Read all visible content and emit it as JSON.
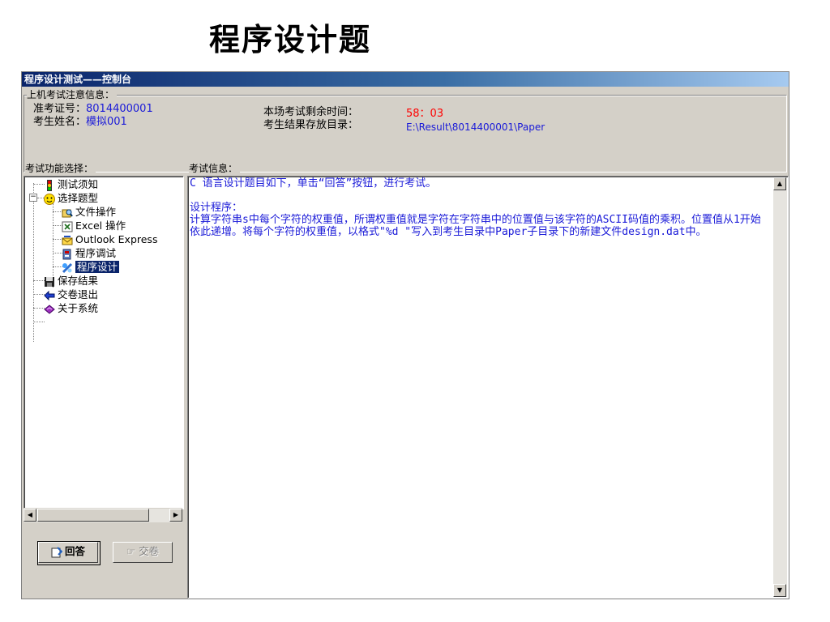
{
  "page": {
    "heading": "程序设计题"
  },
  "window": {
    "title": "程序设计测试——控制台"
  },
  "info": {
    "group_label": "上机考试注意信息：",
    "exam_id_label": "准考证号：",
    "exam_id_value": "8014400001",
    "name_label": "考生姓名：",
    "name_value": "模拟001",
    "time_label": "本场考试剩余时间：",
    "time_value": "58：03",
    "dir_label": "考生结果存放目录：",
    "dir_value": "E:\\Result\\8014400001\\Paper"
  },
  "left": {
    "group_label": "考试功能选择：",
    "tree": [
      {
        "label": "测试须知",
        "icon": "traffic-light-icon"
      },
      {
        "label": "选择题型",
        "icon": "smiley-icon"
      },
      {
        "label": "文件操作",
        "icon": "file-search-icon"
      },
      {
        "label": "Excel 操作",
        "icon": "excel-icon"
      },
      {
        "label": "Outlook Express",
        "icon": "outlook-icon"
      },
      {
        "label": "程序调试",
        "icon": "debug-icon"
      },
      {
        "label": "程序设计",
        "icon": "program-design-icon"
      },
      {
        "label": "保存结果",
        "icon": "floppy-disk-icon"
      },
      {
        "label": "交卷退出",
        "icon": "exit-arrow-icon"
      },
      {
        "label": "关于系统",
        "icon": "about-book-icon"
      }
    ],
    "answer_button": "回答",
    "submit_button": "交卷"
  },
  "right": {
    "group_label": "考试信息：",
    "line1": "C 语言设计题目如下，单击“回答”按钮，进行考试。",
    "line2": "设计程序：",
    "line3": "计算字符串s中每个字符的权重值，所谓权重值就是字符在字符串中的位置值与该字符的ASCII码值的乘积。位置值从1开始依此递增。将每个字符的权重值，以格式\"%d \"写入到考生目录中Paper子目录下的新建文件design.dat中。"
  },
  "colors": {
    "title_gradient_start": "#0a246a",
    "text_blue": "#1a1ad8",
    "time_red": "#ff0000",
    "window_bg": "#d4d0c8"
  }
}
